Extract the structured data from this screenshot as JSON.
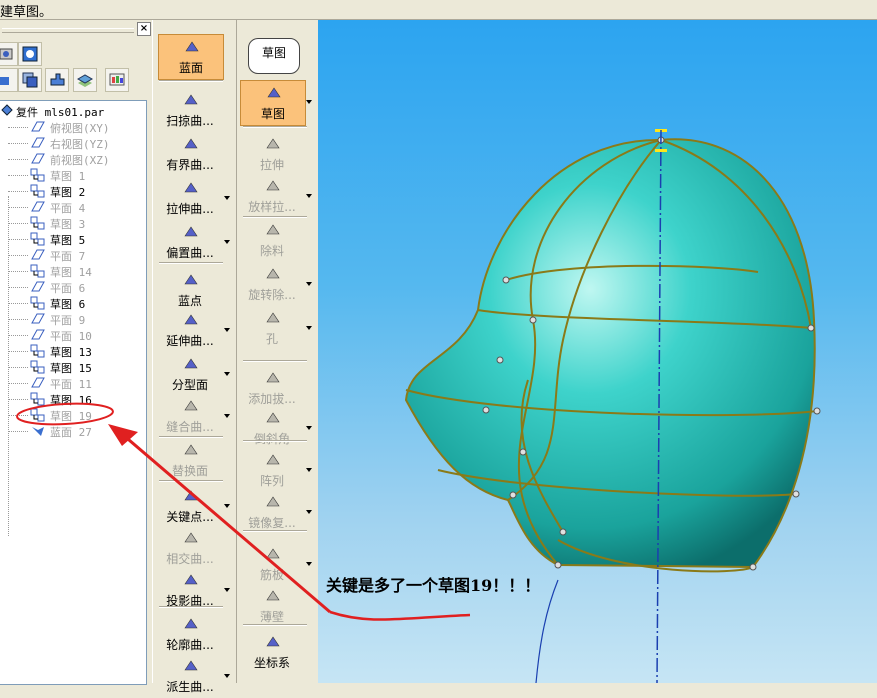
{
  "title_fragment": "建草图。",
  "tree": {
    "root_label": "复件 mls01.par",
    "items": [
      {
        "label": "俯视图(XY)",
        "dim": true,
        "type": "plane"
      },
      {
        "label": "右视图(YZ)",
        "dim": true,
        "type": "plane"
      },
      {
        "label": "前视图(XZ)",
        "dim": true,
        "type": "plane"
      },
      {
        "label": "草图 1",
        "dim": true,
        "type": "sketch"
      },
      {
        "label": "草图 2",
        "dim": false,
        "type": "sketch"
      },
      {
        "label": "平面 4",
        "dim": true,
        "type": "plane"
      },
      {
        "label": "草图 3",
        "dim": true,
        "type": "sketch"
      },
      {
        "label": "草图 5",
        "dim": false,
        "type": "sketch"
      },
      {
        "label": "平面 7",
        "dim": true,
        "type": "plane"
      },
      {
        "label": "草图 14",
        "dim": true,
        "type": "sketch"
      },
      {
        "label": "平面 6",
        "dim": true,
        "type": "plane"
      },
      {
        "label": "草图 6",
        "dim": false,
        "type": "sketch"
      },
      {
        "label": "平面 9",
        "dim": true,
        "type": "plane"
      },
      {
        "label": "平面 10",
        "dim": true,
        "type": "plane"
      },
      {
        "label": "草图 13",
        "dim": false,
        "type": "sketch"
      },
      {
        "label": "草图 15",
        "dim": false,
        "type": "sketch"
      },
      {
        "label": "平面 11",
        "dim": true,
        "type": "plane"
      },
      {
        "label": "草图 16",
        "dim": false,
        "type": "sketch"
      },
      {
        "label": "草图 19",
        "dim": true,
        "type": "sketch"
      },
      {
        "label": "蓝面 27",
        "dim": true,
        "type": "surface"
      }
    ]
  },
  "col1": [
    {
      "label": "蓝面",
      "active": true,
      "dim": false,
      "arrow": false
    },
    {
      "label": "扫掠曲...",
      "dim": false,
      "arrow": false
    },
    {
      "label": "有界曲...",
      "dim": false,
      "arrow": false
    },
    {
      "label": "拉伸曲...",
      "dim": false,
      "arrow": true
    },
    {
      "label": "偏置曲...",
      "dim": false,
      "arrow": true
    },
    {
      "label": "蓝点",
      "dim": false,
      "arrow": false
    },
    {
      "label": "延伸曲...",
      "dim": false,
      "arrow": true
    },
    {
      "label": "分型面",
      "dim": false,
      "arrow": true
    },
    {
      "label": "缝合曲...",
      "dim": true,
      "arrow": true
    },
    {
      "label": "替换面",
      "dim": true,
      "arrow": false
    },
    {
      "label": "关键点...",
      "dim": false,
      "arrow": true
    },
    {
      "label": "相交曲...",
      "dim": true,
      "arrow": false
    },
    {
      "label": "投影曲...",
      "dim": false,
      "arrow": true
    },
    {
      "label": "轮廓曲...",
      "dim": false,
      "arrow": false
    },
    {
      "label": "派生曲...",
      "dim": false,
      "arrow": true
    }
  ],
  "col2": [
    {
      "label": "草图",
      "active": true,
      "dim": false,
      "arrow": true
    },
    {
      "label": "拉伸",
      "dim": true,
      "arrow": false
    },
    {
      "label": "放样拉...",
      "dim": true,
      "arrow": true
    },
    {
      "label": "除料",
      "dim": true,
      "arrow": false
    },
    {
      "label": "旋转除...",
      "dim": true,
      "arrow": true
    },
    {
      "label": "孔",
      "dim": true,
      "arrow": true
    },
    {
      "label": "添加拔...",
      "dim": true,
      "arrow": false
    },
    {
      "label": "倒斜角",
      "dim": true,
      "arrow": true
    },
    {
      "label": "阵列",
      "dim": true,
      "arrow": true
    },
    {
      "label": "镜像复...",
      "dim": true,
      "arrow": true
    },
    {
      "label": "筋板",
      "dim": true,
      "arrow": true
    },
    {
      "label": "薄壁",
      "dim": true,
      "arrow": false
    },
    {
      "label": "坐标系",
      "dim": false,
      "arrow": false
    }
  ],
  "tooltip": "草图",
  "annotation": "关键是多了一个草图19！！！",
  "colors": {
    "surface": "#2fc7c0",
    "edge": "#8a7a18",
    "annotation": "#e02020",
    "axis": "#1a3fb0"
  }
}
